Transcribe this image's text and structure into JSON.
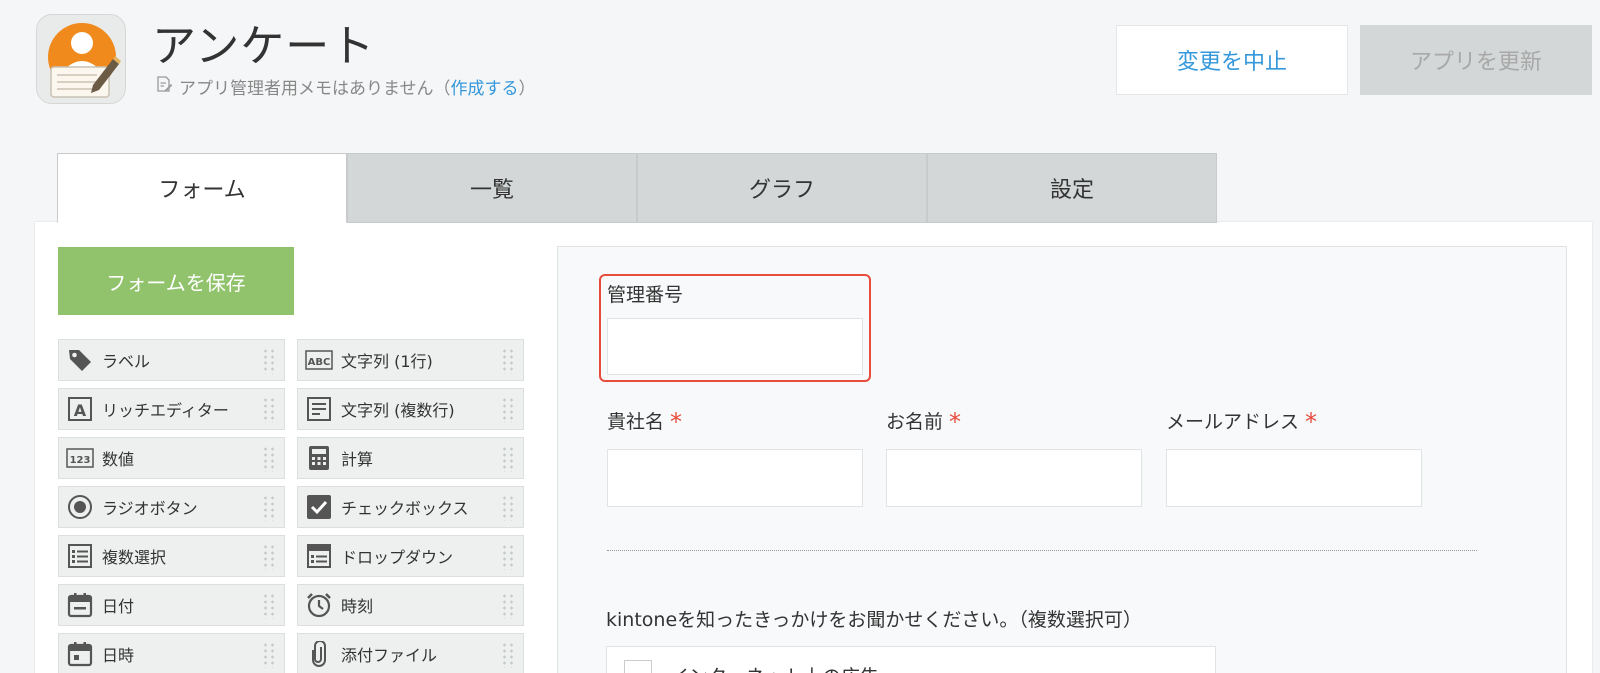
{
  "app": {
    "title": "アンケート",
    "memo_text": "アプリ管理者用メモはありません（",
    "memo_link": "作成する",
    "memo_close": "）"
  },
  "header": {
    "cancel_label": "変更を中止",
    "update_label": "アプリを更新"
  },
  "tabs": [
    {
      "label": "フォーム",
      "active": true
    },
    {
      "label": "一覧"
    },
    {
      "label": "グラフ"
    },
    {
      "label": "設定"
    }
  ],
  "save_label": "フォームを保存",
  "palette": [
    {
      "label": "ラベル",
      "icon": "tag-icon"
    },
    {
      "label": "文字列 (1行)",
      "icon": "abc-icon"
    },
    {
      "label": "リッチエディター",
      "icon": "rich-editor-icon"
    },
    {
      "label": "文字列 (複数行)",
      "icon": "multiline-text-icon"
    },
    {
      "label": "数値",
      "icon": "number-icon"
    },
    {
      "label": "計算",
      "icon": "calculator-icon"
    },
    {
      "label": "ラジオボタン",
      "icon": "radio-icon"
    },
    {
      "label": "チェックボックス",
      "icon": "checkbox-icon"
    },
    {
      "label": "複数選択",
      "icon": "multi-select-icon"
    },
    {
      "label": "ドロップダウン",
      "icon": "dropdown-icon"
    },
    {
      "label": "日付",
      "icon": "calendar-icon"
    },
    {
      "label": "時刻",
      "icon": "clock-icon"
    },
    {
      "label": "日時",
      "icon": "datetime-icon"
    },
    {
      "label": "添付ファイル",
      "icon": "paperclip-icon"
    }
  ],
  "form": {
    "field_kanri": "管理番号",
    "field_company": "貴社名",
    "field_name": "お名前",
    "field_email": "メールアドレス",
    "required_mark": "*",
    "question": "kintoneを知ったきっかけをお聞かせください。（複数選択可）",
    "choice_1": "インターネット上の広告"
  },
  "colors": {
    "accent": "#3498db",
    "save": "#91c36c",
    "required": "#e74c3c"
  }
}
